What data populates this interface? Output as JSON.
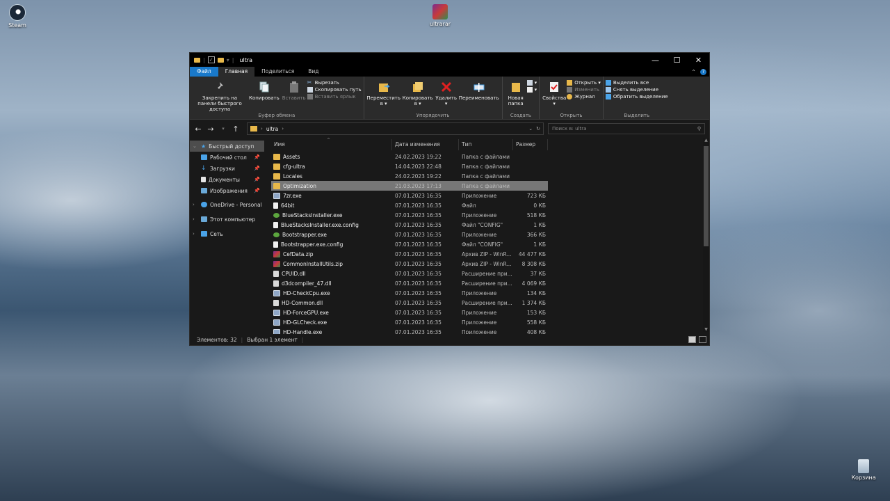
{
  "desktop": {
    "icons": [
      {
        "label": "Steam",
        "icon": "steam-icon"
      },
      {
        "label": "ultrarar",
        "icon": "winrar-archive-icon"
      },
      {
        "label": "Корзина",
        "icon": "recycle-bin-icon"
      }
    ]
  },
  "window": {
    "title": "ultra",
    "controls": {
      "minimize": "—",
      "maximize": "☐",
      "close": "✕"
    }
  },
  "ribbon_tabs": [
    "Файл",
    "Главная",
    "Поделиться",
    "Вид"
  ],
  "ribbon": {
    "clipboard": {
      "pin": "Закрепить на панели быстрого доступа",
      "copy": "Копировать",
      "paste": "Вставить",
      "cut": "Вырезать",
      "copy_path": "Скопировать путь",
      "paste_shortcut": "Вставить ярлык",
      "label": "Буфер обмена"
    },
    "organize": {
      "move": "Переместить в ▾",
      "copyto": "Копировать в ▾",
      "delete": "Удалить ▾",
      "rename": "Переименовать",
      "label": "Упорядочить"
    },
    "create": {
      "new_folder": "Новая папка",
      "label": "Создать"
    },
    "open": {
      "properties": "Свойства ▾",
      "open": "Открыть ▾",
      "edit": "Изменить",
      "history": "Журнал",
      "label": "Открыть"
    },
    "select": {
      "select_all": "Выделить все",
      "select_none": "Снять выделение",
      "invert": "Обратить выделение",
      "label": "Выделить"
    }
  },
  "address": {
    "path": "ultra",
    "search_placeholder": "Поиск в: ultra"
  },
  "nav_pane": {
    "quick_access": "Быстрый доступ",
    "items": [
      {
        "label": "Рабочий стол",
        "icon": "desktop-icon"
      },
      {
        "label": "Загрузки",
        "icon": "downloads-icon"
      },
      {
        "label": "Документы",
        "icon": "documents-icon"
      },
      {
        "label": "Изображения",
        "icon": "pictures-icon"
      }
    ],
    "onedrive": "OneDrive - Personal",
    "this_pc": "Этот компьютер",
    "network": "Сеть"
  },
  "columns": {
    "name": "Имя",
    "date": "Дата изменения",
    "type": "Тип",
    "size": "Размер"
  },
  "files": [
    {
      "name": "Assets",
      "date": "24.02.2023 19:22",
      "type": "Папка с файлами",
      "size": "",
      "icon": "folder"
    },
    {
      "name": "cfg-ultra",
      "date": "14.04.2023 22:48",
      "type": "Папка с файлами",
      "size": "",
      "icon": "folder"
    },
    {
      "name": "Locales",
      "date": "24.02.2023 19:22",
      "type": "Папка с файлами",
      "size": "",
      "icon": "folder"
    },
    {
      "name": "Optimization",
      "date": "21.03.2023 17:13",
      "type": "Папка с файлами",
      "size": "",
      "icon": "folder",
      "selected": true
    },
    {
      "name": "7zr.exe",
      "date": "07.01.2023 16:35",
      "type": "Приложение",
      "size": "723 КБ",
      "icon": "exe"
    },
    {
      "name": "64bit",
      "date": "07.01.2023 16:35",
      "type": "Файл",
      "size": "0 КБ",
      "icon": "file"
    },
    {
      "name": "BlueStacksInstaller.exe",
      "date": "07.01.2023 16:35",
      "type": "Приложение",
      "size": "518 КБ",
      "icon": "bs"
    },
    {
      "name": "BlueStacksInstaller.exe.config",
      "date": "07.01.2023 16:35",
      "type": "Файл \"CONFIG\"",
      "size": "1 КБ",
      "icon": "file"
    },
    {
      "name": "Bootstrapper.exe",
      "date": "07.01.2023 16:35",
      "type": "Приложение",
      "size": "366 КБ",
      "icon": "bs"
    },
    {
      "name": "Bootstrapper.exe.config",
      "date": "07.01.2023 16:35",
      "type": "Файл \"CONFIG\"",
      "size": "1 КБ",
      "icon": "file"
    },
    {
      "name": "CefData.zip",
      "date": "07.01.2023 16:35",
      "type": "Архив ZIP - WinR...",
      "size": "44 477 КБ",
      "icon": "zip"
    },
    {
      "name": "CommonInstallUtils.zip",
      "date": "07.01.2023 16:35",
      "type": "Архив ZIP - WinR...",
      "size": "8 308 КБ",
      "icon": "zip"
    },
    {
      "name": "CPUID.dll",
      "date": "07.01.2023 16:35",
      "type": "Расширение при...",
      "size": "37 КБ",
      "icon": "dll"
    },
    {
      "name": "d3dcompiler_47.dll",
      "date": "07.01.2023 16:35",
      "type": "Расширение при...",
      "size": "4 069 КБ",
      "icon": "dll"
    },
    {
      "name": "HD-CheckCpu.exe",
      "date": "07.01.2023 16:35",
      "type": "Приложение",
      "size": "134 КБ",
      "icon": "exe"
    },
    {
      "name": "HD-Common.dll",
      "date": "07.01.2023 16:35",
      "type": "Расширение при...",
      "size": "1 374 КБ",
      "icon": "dll"
    },
    {
      "name": "HD-ForceGPU.exe",
      "date": "07.01.2023 16:35",
      "type": "Приложение",
      "size": "153 КБ",
      "icon": "exe"
    },
    {
      "name": "HD-GLCheck.exe",
      "date": "07.01.2023 16:35",
      "type": "Приложение",
      "size": "558 КБ",
      "icon": "exe"
    },
    {
      "name": "HD-Handle.exe",
      "date": "07.01.2023 16:35",
      "type": "Приложение",
      "size": "408 КБ",
      "icon": "exe"
    }
  ],
  "status": {
    "count": "Элементов: 32",
    "selected": "Выбран 1 элемент"
  },
  "colors": {
    "accent": "#1979ca",
    "folder": "#e8b84a",
    "background": "#191919",
    "ribbon": "#2b2b2b"
  }
}
